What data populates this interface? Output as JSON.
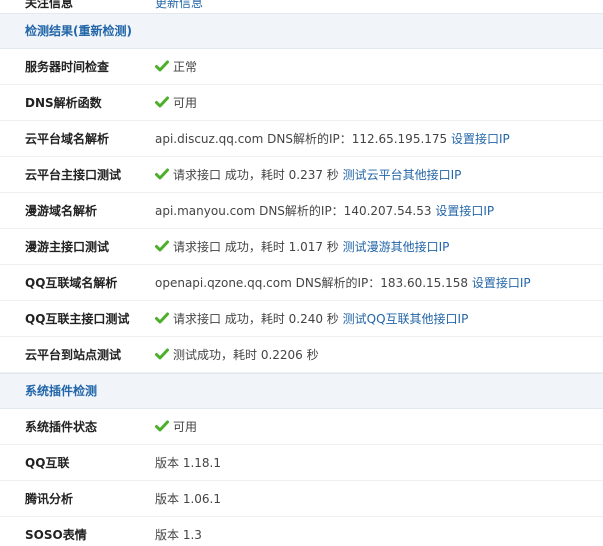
{
  "colors": {
    "section_bg": "#f1f5fa",
    "link": "#2366a8",
    "check": "#4caf2a"
  },
  "top_row": {
    "label": "关注信息",
    "link": "更新信息"
  },
  "sections": {
    "detect": "检测结果(重新检测)",
    "plugins": "系统插件检测"
  },
  "rows": [
    {
      "key": "服务器时间检查",
      "check": true,
      "text": "正常",
      "link": ""
    },
    {
      "key": "DNS解析函数",
      "check": true,
      "text": "可用",
      "link": ""
    },
    {
      "key": "云平台域名解析",
      "check": false,
      "text": "api.discuz.qq.com DNS解析的IP：112.65.195.175",
      "link": "设置接口IP"
    },
    {
      "key": "云平台主接口测试",
      "check": true,
      "text": "请求接口 成功，耗时 0.237 秒",
      "link": "测试云平台其他接口IP"
    },
    {
      "key": "漫游域名解析",
      "check": false,
      "text": "api.manyou.com DNS解析的IP：140.207.54.53",
      "link": "设置接口IP"
    },
    {
      "key": "漫游主接口测试",
      "check": true,
      "text": "请求接口 成功，耗时 1.017 秒",
      "link": "测试漫游其他接口IP"
    },
    {
      "key": "QQ互联域名解析",
      "check": false,
      "text": "openapi.qzone.qq.com DNS解析的IP：183.60.15.158",
      "link": "设置接口IP"
    },
    {
      "key": "QQ互联主接口测试",
      "check": true,
      "text": "请求接口 成功，耗时 0.240 秒",
      "link": "测试QQ互联其他接口IP"
    },
    {
      "key": "云平台到站点测试",
      "check": true,
      "text": "测试成功，耗时 0.2206 秒",
      "link": ""
    }
  ],
  "plugin_rows": [
    {
      "key": "系统插件状态",
      "check": true,
      "text": "可用",
      "link": ""
    },
    {
      "key": "QQ互联",
      "check": false,
      "text": "版本 1.18.1",
      "link": ""
    },
    {
      "key": "腾讯分析",
      "check": false,
      "text": "版本 1.06.1",
      "link": ""
    },
    {
      "key": "SOSO表情",
      "check": false,
      "text": "版本 1.3",
      "link": ""
    }
  ]
}
